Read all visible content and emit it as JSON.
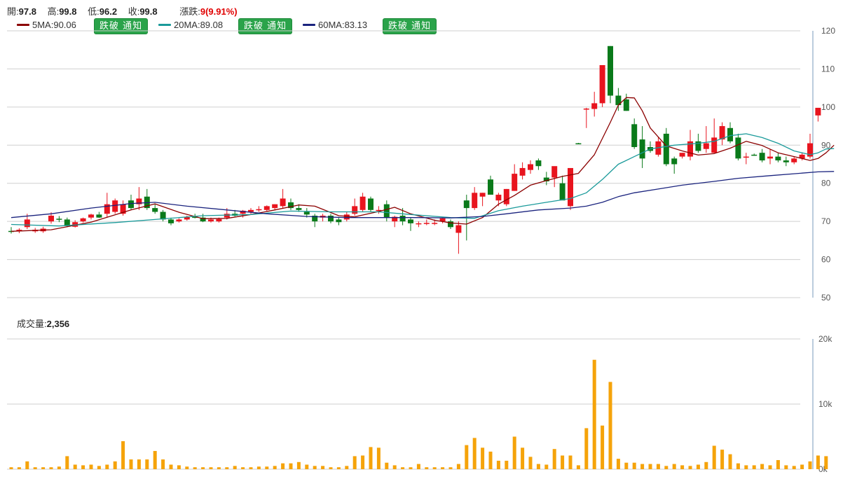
{
  "quote": {
    "open_label": "開:",
    "open": "97.8",
    "high_label": "高:",
    "high": "99.8",
    "low_label": "低:",
    "low": "96.2",
    "close_label": "收:",
    "close": "99.8",
    "change_label": "漲跌:",
    "change": "9(9.91%)"
  },
  "ma": {
    "ma5": {
      "label": "5MA:90.06",
      "color": "#8b0000"
    },
    "ma20": {
      "label": "20MA:89.08",
      "color": "#1a9a9a"
    },
    "ma60": {
      "label": "60MA:83.13",
      "color": "#1a237e"
    },
    "alert_button": "跌破 通知"
  },
  "volume": {
    "label": "成交量:",
    "value": "2,356"
  },
  "colors": {
    "up": "#e8141e",
    "down": "#0a7a1a",
    "volume": "#f5a30a",
    "grid": "#cfcfcf"
  },
  "chart_data": [
    {
      "type": "candlestick",
      "ylim": [
        50,
        120
      ],
      "y_ticks": [
        "120",
        "110",
        "100",
        "90",
        "80",
        "70",
        "60",
        "50"
      ],
      "y_tick_values": [
        120,
        110,
        100,
        90,
        80,
        70,
        60,
        50
      ],
      "ohlc": [
        [
          67.5,
          68.5,
          66.8,
          67.3
        ],
        [
          67.4,
          68.2,
          66.9,
          67.8
        ],
        [
          68.5,
          72.0,
          68.0,
          70.5
        ],
        [
          67.4,
          68.3,
          67.0,
          67.8
        ],
        [
          67.4,
          68.6,
          67.0,
          68.1
        ],
        [
          70.0,
          72.4,
          69.4,
          71.5
        ],
        [
          70.7,
          71.4,
          69.8,
          70.5
        ],
        [
          70.5,
          71.0,
          68.5,
          68.8
        ],
        [
          68.6,
          70.3,
          68.4,
          69.8
        ],
        [
          70.0,
          71.0,
          69.7,
          70.8
        ],
        [
          71.0,
          72.0,
          70.5,
          71.8
        ],
        [
          71.8,
          72.5,
          70.9,
          71.0
        ],
        [
          72.0,
          77.5,
          71.0,
          74.5
        ],
        [
          72.5,
          76.0,
          72.0,
          75.5
        ],
        [
          72.0,
          75.5,
          71.5,
          74.5
        ],
        [
          75.5,
          77.0,
          73.0,
          73.5
        ],
        [
          74.5,
          79.0,
          73.0,
          76.0
        ],
        [
          76.5,
          78.5,
          73.0,
          73.5
        ],
        [
          73.5,
          74.5,
          72.0,
          72.5
        ],
        [
          72.5,
          73.0,
          70.0,
          70.5
        ],
        [
          70.5,
          71.0,
          69.0,
          69.5
        ],
        [
          70.0,
          70.8,
          69.7,
          70.5
        ],
        [
          70.5,
          71.5,
          70.2,
          71.2
        ],
        [
          71.2,
          72.0,
          70.8,
          71.0
        ],
        [
          71.0,
          72.0,
          69.8,
          70.0
        ],
        [
          70.0,
          71.0,
          69.7,
          70.5
        ],
        [
          70.0,
          71.0,
          69.7,
          70.6
        ],
        [
          71.0,
          73.5,
          70.5,
          72.0
        ],
        [
          72.0,
          73.0,
          71.3,
          71.5
        ],
        [
          72.0,
          73.0,
          71.0,
          72.8
        ],
        [
          72.5,
          73.5,
          72.0,
          73.0
        ],
        [
          73.0,
          74.0,
          72.5,
          73.2
        ],
        [
          73.0,
          74.2,
          72.5,
          74.0
        ],
        [
          73.5,
          74.5,
          73.0,
          74.5
        ],
        [
          74.0,
          78.5,
          73.5,
          76.0
        ],
        [
          75.0,
          76.0,
          73.0,
          73.5
        ],
        [
          73.5,
          74.5,
          72.5,
          73.0
        ],
        [
          72.5,
          73.5,
          71.0,
          71.8
        ],
        [
          71.5,
          72.0,
          68.5,
          70.0
        ],
        [
          71.0,
          72.0,
          70.0,
          71.5
        ],
        [
          71.5,
          72.0,
          69.5,
          70.0
        ],
        [
          70.5,
          71.0,
          69.0,
          69.8
        ],
        [
          70.5,
          72.5,
          70.0,
          71.8
        ],
        [
          72.0,
          76.0,
          71.5,
          74.0
        ],
        [
          73.0,
          77.5,
          72.5,
          76.5
        ],
        [
          76.0,
          76.5,
          72.5,
          73.0
        ],
        [
          73.0,
          74.0,
          72.0,
          73.0
        ],
        [
          74.5,
          75.5,
          70.0,
          71.0
        ],
        [
          70.0,
          71.5,
          68.5,
          71.2
        ],
        [
          71.5,
          73.5,
          69.0,
          70.0
        ],
        [
          70.5,
          71.0,
          67.5,
          69.5
        ],
        [
          69.5,
          70.0,
          68.5,
          69.5
        ],
        [
          69.5,
          70.5,
          69.0,
          69.6
        ],
        [
          69.5,
          70.5,
          69.0,
          69.6
        ],
        [
          70.0,
          71.0,
          69.5,
          70.8
        ],
        [
          70.0,
          70.5,
          68.0,
          68.5
        ],
        [
          67.0,
          70.0,
          61.5,
          69.0
        ],
        [
          75.5,
          77.0,
          65.0,
          73.5
        ],
        [
          73.5,
          79.0,
          73.0,
          77.5
        ],
        [
          76.5,
          77.5,
          74.0,
          77.5
        ],
        [
          81.0,
          82.0,
          77.0,
          77.0
        ],
        [
          75.5,
          77.5,
          74.0,
          77.0
        ],
        [
          74.5,
          78.5,
          74.0,
          78.5
        ],
        [
          78.0,
          85.0,
          78.0,
          82.5
        ],
        [
          82.0,
          85.5,
          81.0,
          84.0
        ],
        [
          83.5,
          86.0,
          82.5,
          85.0
        ],
        [
          86.0,
          86.5,
          83.5,
          84.5
        ],
        [
          81.5,
          83.0,
          79.5,
          80.5
        ],
        [
          81.5,
          84.0,
          79.0,
          84.5
        ],
        [
          80.0,
          82.0,
          76.0,
          75.5
        ],
        [
          74.0,
          84.0,
          73.0,
          84.0
        ],
        [
          90.5,
          90.6,
          90.4,
          90.4
        ],
        [
          99.5,
          99.8,
          94.5,
          99.6
        ],
        [
          99.5,
          104.0,
          97.5,
          101.0
        ],
        [
          101.0,
          111.0,
          100.0,
          111.0
        ],
        [
          116.0,
          116.0,
          101.0,
          103.0
        ],
        [
          103.0,
          105.0,
          99.0,
          100.5
        ],
        [
          102.0,
          103.5,
          99.0,
          99.0
        ],
        [
          95.5,
          97.0,
          89.0,
          89.5
        ],
        [
          91.5,
          95.0,
          84.0,
          86.5
        ],
        [
          89.5,
          91.0,
          88.0,
          88.5
        ],
        [
          87.5,
          92.0,
          87.0,
          91.0
        ],
        [
          93.0,
          94.5,
          84.5,
          85.0
        ],
        [
          86.5,
          87.0,
          82.5,
          85.0
        ],
        [
          87.0,
          88.0,
          86.5,
          88.0
        ],
        [
          87.0,
          94.0,
          86.0,
          91.0
        ],
        [
          91.0,
          93.0,
          88.0,
          88.5
        ],
        [
          89.0,
          95.0,
          88.0,
          90.5
        ],
        [
          88.0,
          97.0,
          88.0,
          92.0
        ],
        [
          91.5,
          96.0,
          90.0,
          95.0
        ],
        [
          94.5,
          96.0,
          90.5,
          91.0
        ],
        [
          92.0,
          93.0,
          86.0,
          86.5
        ],
        [
          87.0,
          88.0,
          85.0,
          87.0
        ],
        [
          87.5,
          87.8,
          87.2,
          87.4
        ],
        [
          88.0,
          89.0,
          85.5,
          86.0
        ],
        [
          86.5,
          89.0,
          85.0,
          87.0
        ],
        [
          87.0,
          88.0,
          85.5,
          86.0
        ],
        [
          86.0,
          87.0,
          84.5,
          85.5
        ],
        [
          85.5,
          87.0,
          85.0,
          86.5
        ],
        [
          86.5,
          88.0,
          86.0,
          87.5
        ],
        [
          87.0,
          93.0,
          86.5,
          90.5
        ],
        [
          97.8,
          99.8,
          96.2,
          99.8
        ]
      ],
      "series": [
        {
          "name": "5MA",
          "color": "#8b0000",
          "points": [
            [
              0,
              67.4
            ],
            [
              5,
              67.8
            ],
            [
              10,
              69.8
            ],
            [
              15,
              73.0
            ],
            [
              18,
              74.6
            ],
            [
              21,
              72.4
            ],
            [
              24,
              70.7
            ],
            [
              27,
              70.8
            ],
            [
              30,
              71.8
            ],
            [
              33,
              73.0
            ],
            [
              36,
              74.3
            ],
            [
              38,
              74.0
            ],
            [
              41,
              71.5
            ],
            [
              43,
              71.2
            ],
            [
              46,
              72.6
            ],
            [
              48,
              73.7
            ],
            [
              50,
              72.0
            ],
            [
              53,
              70.3
            ],
            [
              55,
              69.6
            ],
            [
              57,
              69.3
            ],
            [
              59,
              71.0
            ],
            [
              61,
              74.5
            ],
            [
              63,
              76.8
            ],
            [
              65,
              79.5
            ],
            [
              67,
              80.7
            ],
            [
              69,
              81.8
            ],
            [
              71,
              82.6
            ],
            [
              73,
              87.5
            ],
            [
              75,
              96.0
            ],
            [
              76,
              100.5
            ],
            [
              77,
              102.5
            ],
            [
              78,
              102.4
            ],
            [
              79,
              99.0
            ],
            [
              80,
              94.5
            ],
            [
              82,
              89.8
            ],
            [
              84,
              88.5
            ],
            [
              86,
              87.4
            ],
            [
              88,
              87.8
            ],
            [
              90,
              89.2
            ],
            [
              92,
              91.0
            ],
            [
              94,
              89.9
            ],
            [
              96,
              88.0
            ],
            [
              98,
              87.0
            ],
            [
              100,
              86.0
            ],
            [
              101,
              86.5
            ],
            [
              102,
              88.0
            ],
            [
              103,
              90.0
            ]
          ]
        },
        {
          "name": "20MA",
          "color": "#1a9a9a",
          "points": [
            [
              0,
              69.2
            ],
            [
              6,
              68.8
            ],
            [
              13,
              69.7
            ],
            [
              18,
              70.5
            ],
            [
              24,
              71.5
            ],
            [
              30,
              71.8
            ],
            [
              35,
              72.7
            ],
            [
              40,
              72.5
            ],
            [
              46,
              72.5
            ],
            [
              50,
              71.8
            ],
            [
              55,
              71.0
            ],
            [
              58,
              70.8
            ],
            [
              61,
              72.8
            ],
            [
              64,
              74.0
            ],
            [
              67,
              75.0
            ],
            [
              70,
              76.0
            ],
            [
              72,
              77.5
            ],
            [
              74,
              81.0
            ],
            [
              76,
              85.0
            ],
            [
              78,
              87.0
            ],
            [
              80,
              89.0
            ],
            [
              83,
              90.0
            ],
            [
              86,
              90.5
            ],
            [
              88,
              91.0
            ],
            [
              90,
              92.5
            ],
            [
              92,
              93.0
            ],
            [
              94,
              92.0
            ],
            [
              96,
              90.5
            ],
            [
              98,
              88.5
            ],
            [
              100,
              87.5
            ],
            [
              101,
              88.0
            ],
            [
              102,
              89.0
            ],
            [
              103,
              89.1
            ]
          ]
        },
        {
          "name": "60MA",
          "color": "#1a237e",
          "points": [
            [
              0,
              71.0
            ],
            [
              5,
              72.0
            ],
            [
              10,
              73.5
            ],
            [
              15,
              74.7
            ],
            [
              18,
              75.0
            ],
            [
              22,
              74.0
            ],
            [
              27,
              73.0
            ],
            [
              32,
              72.0
            ],
            [
              37,
              71.3
            ],
            [
              42,
              71.0
            ],
            [
              47,
              71.0
            ],
            [
              51,
              71.0
            ],
            [
              55,
              70.9
            ],
            [
              59,
              71.3
            ],
            [
              62,
              72.0
            ],
            [
              66,
              73.0
            ],
            [
              70,
              73.5
            ],
            [
              72,
              74.0
            ],
            [
              74,
              75.0
            ],
            [
              76,
              76.5
            ],
            [
              78,
              77.5
            ],
            [
              81,
              78.5
            ],
            [
              84,
              79.5
            ],
            [
              88,
              80.5
            ],
            [
              91,
              81.3
            ],
            [
              95,
              82.0
            ],
            [
              98,
              82.5
            ],
            [
              101,
              83.0
            ],
            [
              103,
              83.1
            ]
          ]
        }
      ]
    },
    {
      "type": "bar",
      "title": "成交量",
      "ylim": [
        0,
        20000
      ],
      "y_ticks": [
        "20k",
        "10k",
        "0k"
      ],
      "y_tick_values": [
        20000,
        10000,
        0
      ],
      "values": [
        300,
        300,
        1200,
        300,
        300,
        300,
        400,
        2000,
        700,
        600,
        700,
        500,
        700,
        1200,
        4300,
        1500,
        1500,
        1500,
        2800,
        1500,
        700,
        600,
        400,
        300,
        300,
        300,
        300,
        300,
        500,
        300,
        300,
        400,
        400,
        500,
        900,
        900,
        1100,
        700,
        500,
        500,
        300,
        300,
        500,
        2000,
        2100,
        3400,
        3300,
        1000,
        600,
        300,
        300,
        800,
        300,
        300,
        300,
        300,
        800,
        3700,
        4800,
        3300,
        2700,
        1300,
        1300,
        5000,
        3300,
        1900,
        800,
        700,
        3100,
        2100,
        2100,
        600,
        6300,
        16800,
        6700,
        13400,
        1600,
        1000,
        1000,
        800,
        800,
        800,
        500,
        800,
        600,
        500,
        700,
        1100,
        3600,
        3000,
        2300,
        900,
        600,
        600,
        800,
        600,
        1400,
        600,
        500,
        700,
        1200,
        2100,
        2000
      ]
    }
  ]
}
